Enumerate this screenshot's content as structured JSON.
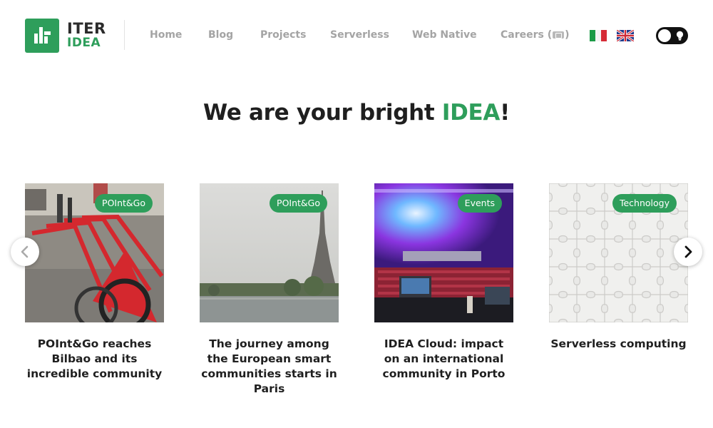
{
  "logo": {
    "line1": "ITER",
    "line2": "IDEA"
  },
  "nav": {
    "items": [
      {
        "label": "Home"
      },
      {
        "label": "Blog"
      },
      {
        "label": "Projects"
      },
      {
        "label": "Serverless"
      },
      {
        "label": "Web Native"
      }
    ],
    "careers": {
      "label": "Careers",
      "paren_open": "(",
      "paren_close": ")"
    }
  },
  "languages": [
    "Italian",
    "English"
  ],
  "theme_toggle": {
    "state": "off"
  },
  "hero": {
    "prefix": "We are your bright ",
    "accent": "IDEA",
    "suffix": "!"
  },
  "colors": {
    "brand_green": "#2e9e5b",
    "nav_text": "#a4a4a4",
    "title_text": "#1f1f1f"
  },
  "carousel": {
    "cards": [
      {
        "category": "POInt&Go",
        "title": "POInt&Go reaches Bilbao and its incredible community"
      },
      {
        "category": "POInt&Go",
        "title": "The journey among the European smart communities starts in Paris"
      },
      {
        "category": "Events",
        "title": "IDEA Cloud: impact on an international community in Porto"
      },
      {
        "category": "Technology",
        "title": "Serverless computing"
      }
    ],
    "prev_icon": "chevron-left-icon",
    "next_icon": "chevron-right-icon"
  }
}
